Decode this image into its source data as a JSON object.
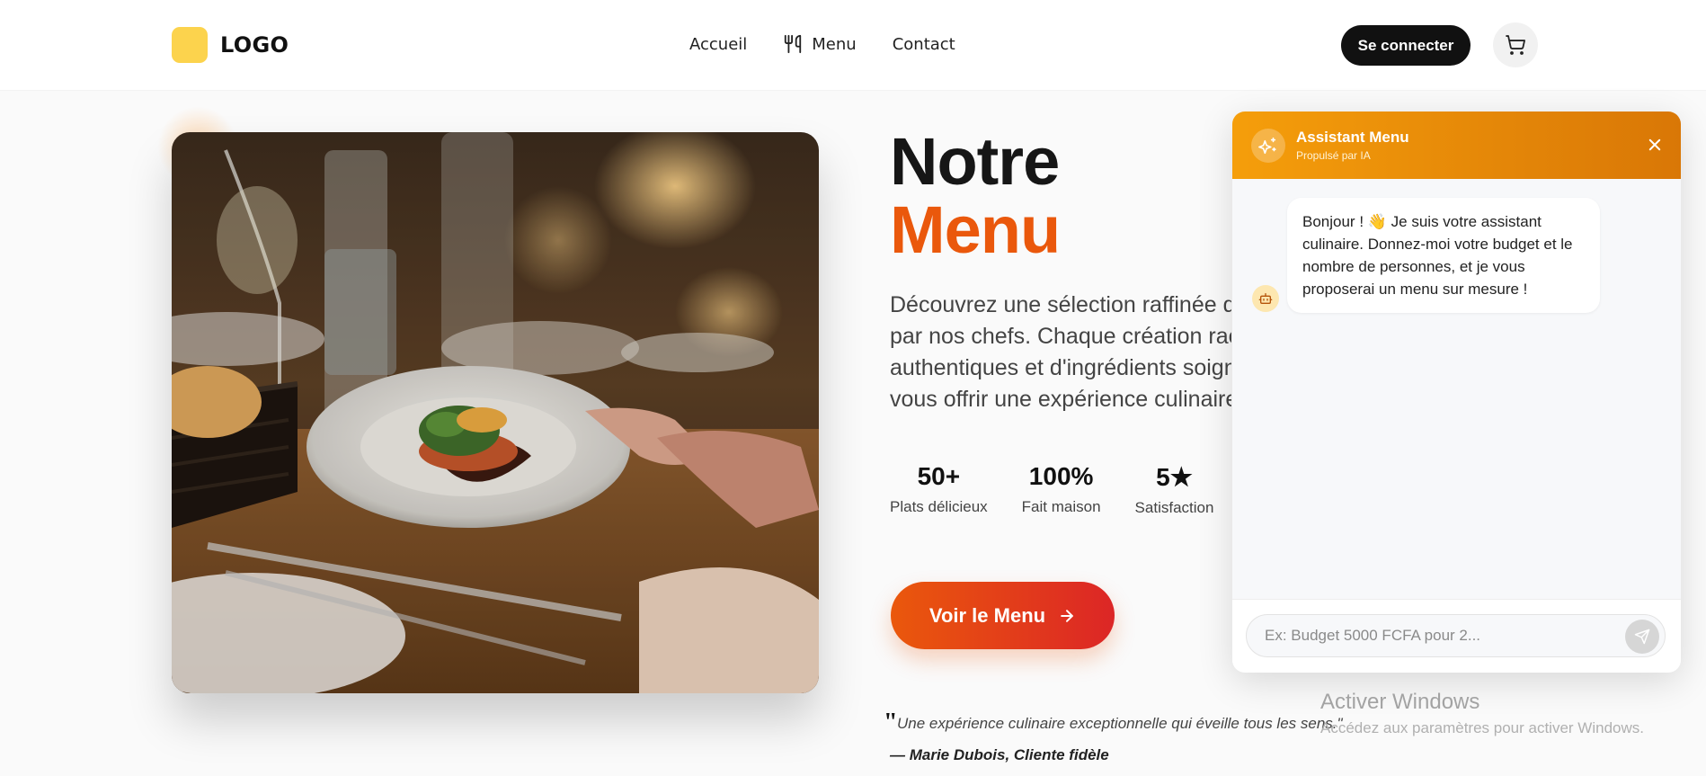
{
  "header": {
    "logo_text": "LOGO",
    "nav": [
      {
        "label": "Accueil"
      },
      {
        "label": "Menu"
      },
      {
        "label": "Contact"
      }
    ],
    "login_label": "Se connecter"
  },
  "hero": {
    "title_line1": "Notre",
    "title_line2": "Menu",
    "description_lines": [
      "Découvrez une sélection raffinée d",
      "par nos chefs. Chaque création rac",
      "authentiques et d'ingrédients soign",
      "vous offrir une expérience culinaire"
    ],
    "stats": [
      {
        "value": "50+",
        "label": "Plats délicieux"
      },
      {
        "value": "100%",
        "label": "Fait maison"
      },
      {
        "value": "5★",
        "label": "Satisfaction"
      }
    ],
    "cta_label": "Voir le Menu",
    "quote": "Une expérience culinaire exceptionnelle qui éveille tous les sens.\"",
    "quote_author": "— Marie Dubois, Cliente fidèle"
  },
  "chat": {
    "title": "Assistant Menu",
    "subtitle": "Propulsé par IA",
    "message": "Bonjour ! 👋 Je suis votre assistant culinaire. Donnez-moi votre budget et le nombre de personnes, et je vous proposerai un menu sur mesure !",
    "input_placeholder": "Ex: Budget 5000 FCFA pour 2...",
    "input_value": ""
  },
  "watermark": {
    "title": "Activer Windows",
    "subtitle": "Accédez aux paramètres pour activer Windows."
  },
  "colors": {
    "accent": "#ea580c",
    "accent_end": "#dc2626",
    "chat_header": "#f59e0b",
    "logo": "#fcd34d",
    "dark": "#111111"
  },
  "icons": {
    "nav_menu": "utensils-icon",
    "cart": "cart-icon",
    "cta": "arrow-right-icon",
    "chat_avatar": "sparkles-icon",
    "chat_close": "close-icon",
    "bot": "bot-icon",
    "send": "send-icon"
  }
}
